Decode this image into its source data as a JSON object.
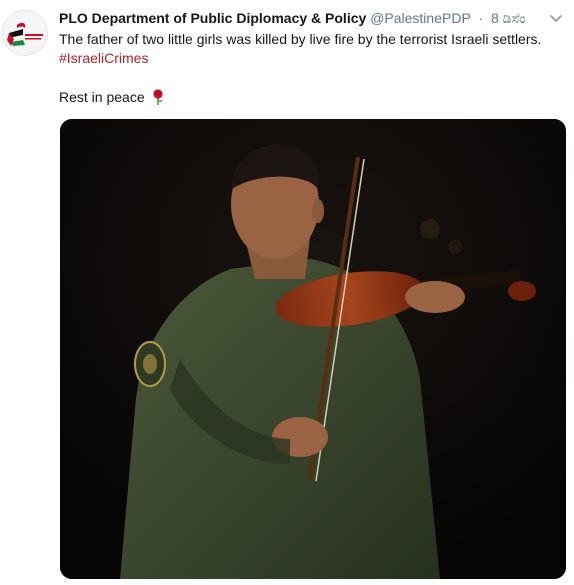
{
  "tweet": {
    "author_name": "PLO Department of Public Diplomacy & Policy",
    "author_handle": "@PalestinePDP",
    "separator": "·",
    "timestamp": "8 ಡಿಸೆಂ",
    "text_line": "The father of two little girls was killed by live fire by the terrorist Israeli settlers.",
    "hashtag": "#IsraeliCrimes",
    "closing": "Rest in peace"
  },
  "colors": {
    "hashtag": "#b0212a",
    "muted": "#657786",
    "text": "#14171a"
  },
  "icons": {
    "avatar": "plo-logo",
    "caret": "chevron-down-icon",
    "emoji": "rose-emoji"
  }
}
